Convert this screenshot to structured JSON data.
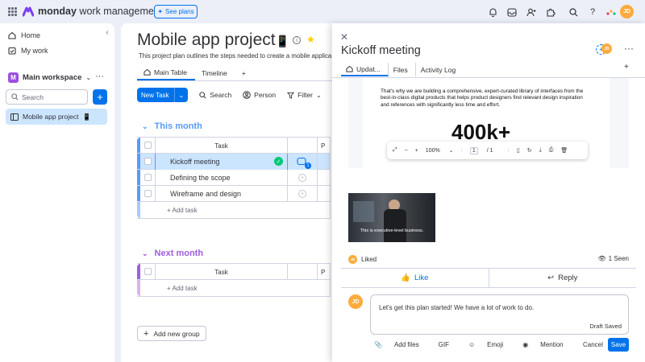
{
  "app": {
    "logo_text": "monday",
    "brand_rest": "work management",
    "see_plans": "See plans",
    "avatar_initials": "JD"
  },
  "sidebar": {
    "home": "Home",
    "my_work": "My work",
    "workspace_badge": "M",
    "workspace_name": "Main workspace",
    "search_placeholder": "Search",
    "board_name": "Mobile app project"
  },
  "board": {
    "title": "Mobile app project",
    "description": "This project plan outlines the steps needed to create a mobile applica",
    "views": [
      "Main Table",
      "Timeline"
    ],
    "toolbar": {
      "new_task": "New Task",
      "search": "Search",
      "person": "Person",
      "filter": "Filter"
    },
    "groups": [
      {
        "title": "This month",
        "color": "#579bfc",
        "column_header": "Task",
        "col_p": "P",
        "rows": [
          "Kickoff meeting",
          "Defining the scope",
          "Wireframe and design"
        ],
        "add_task": "+ Add task"
      },
      {
        "title": "Next month",
        "color": "#a25ddc",
        "column_header": "Task",
        "col_p": "P",
        "rows": [],
        "add_task": "+ Add task"
      }
    ],
    "update_count": "1",
    "add_group": "Add new group"
  },
  "panel": {
    "title": "Kickoff meeting",
    "tabs": [
      "Updat...",
      "Files",
      "Activity Log"
    ],
    "doc_text": "That's why we are building a comprehensive, expert-curated library of interfaces from the best-in-class digital products that helps product designers find relevant design inspiration and references with significantly less time and effort.",
    "doc_big": "400k+",
    "pdf_toolbar": {
      "zoom": "100%",
      "page_current": "1",
      "page_total": "/ 1"
    },
    "video_subtitle": "This is executive-level business.",
    "liked": "Liked",
    "seen": "1 Seen",
    "like_btn": "Like",
    "reply_btn": "Reply",
    "reply_text": "Let's get this plan started! We have a lot of work to do.",
    "draft_status": "Draft Saved",
    "reply_tools": {
      "add_files": "Add files",
      "gif": "GIF",
      "emoji": "Emoji",
      "mention": "Mention"
    },
    "cancel": "Cancel",
    "save": "Save"
  },
  "colors": {
    "accent": "#0073ea",
    "selected_row": "#cce5ff",
    "avatar": "#fdab3d",
    "done_green": "#00c875"
  }
}
